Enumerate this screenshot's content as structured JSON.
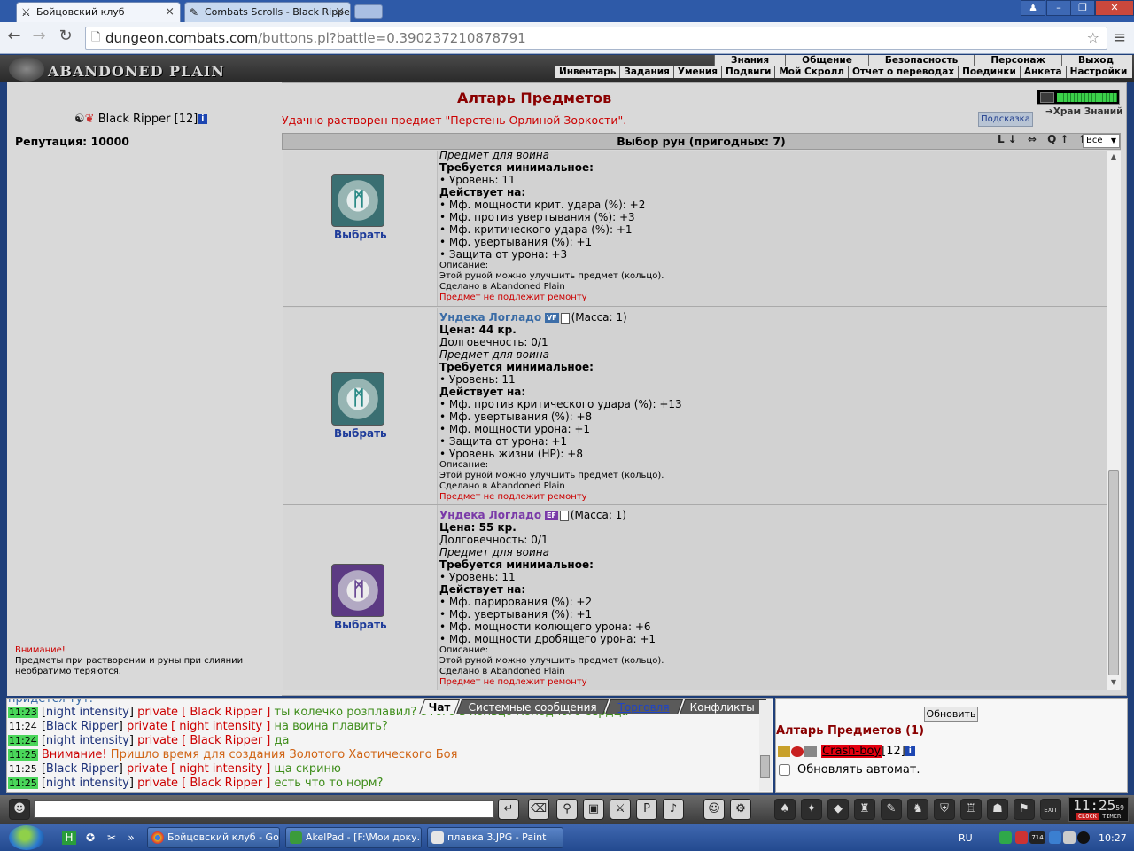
{
  "browser": {
    "tabs": [
      {
        "title": "Бойцовский клуб"
      },
      {
        "title": "Combats Scrolls - Black Ripper"
      }
    ],
    "url_host": "dungeon.combats.com",
    "url_path": "/buttons.pl?battle=0.390237210878791"
  },
  "game": {
    "logo": "ABANDONED PLAIN",
    "menu_top": [
      "Знания",
      "Общение",
      "Безопасность",
      "Персонаж",
      "Выход"
    ],
    "menu_bottom": [
      "Инвентарь",
      "Задания",
      "Умения",
      "Подвиги",
      "Мой Скролл",
      "Отчет о переводах",
      "Поединки",
      "Анкета",
      "Настройки"
    ]
  },
  "character": {
    "name": "Black Ripper",
    "level": "[12]",
    "reputation": "Репутация: 10000"
  },
  "page": {
    "title": "Алтарь Предметов",
    "status": "Удачно растворен предмет \"Перстень Орлиной Зоркости\".",
    "hint_button": "Подсказка",
    "temple_link": "Храм Знаний",
    "runes_header": "Выбор рун (пригодных: 7)",
    "sort_icons": "L↓ ⇔ Q↑ ⇅ ↺",
    "filter_value": "Все",
    "warning_title": "Внимание!",
    "warning_text": "Предметы при растворении и руны при слиянии необратимо теряются."
  },
  "items": [
    {
      "choose": "Выбрать",
      "partial_top": "Предмет для воина",
      "req_title": "Требуется минимальное:",
      "req": [
        "• Уровень: 11"
      ],
      "acts_title": "Действует на:",
      "acts": [
        "• Мф. мощности крит. удара (%): +2",
        "• Мф. против увертывания (%): +3",
        "• Мф. критического удара (%): +1",
        "• Мф. увертывания (%): +1",
        "• Защита от урона: +3"
      ],
      "desc_title": "Описание:",
      "desc": "Этой руной можно улучшить предмет (кольцо).",
      "made": "Сделано в Abandoned Plain",
      "repair": "Предмет не подлежит ремонту"
    },
    {
      "choose": "Выбрать",
      "name": "Ундека Логладо",
      "badge": "VF",
      "mass": "(Масса: 1)",
      "price": "Цена: 44 кр.",
      "durability": "Долговечность: 0/1",
      "for_class": "Предмет для воина",
      "req_title": "Требуется минимальное:",
      "req": [
        "• Уровень: 11"
      ],
      "acts_title": "Действует на:",
      "acts": [
        "• Мф. против критического удара (%): +13",
        "• Мф. увертывания (%): +8",
        "• Мф. мощности урона: +1",
        "• Защита от урона: +1",
        "• Уровень жизни (HP): +8"
      ],
      "desc_title": "Описание:",
      "desc": "Этой руной можно улучшить предмет (кольцо).",
      "made": "Сделано в Abandoned Plain",
      "repair": "Предмет не подлежит ремонту"
    },
    {
      "choose": "Выбрать",
      "name": "Ундека Логладо",
      "badge": "EF",
      "mass": "(Масса: 1)",
      "price": "Цена: 55 кр.",
      "durability": "Долговечность: 0/1",
      "for_class": "Предмет для воина",
      "req_title": "Требуется минимальное:",
      "req": [
        "• Уровень: 11"
      ],
      "acts_title": "Действует на:",
      "acts": [
        "• Мф. парирования (%): +2",
        "• Мф. увертывания (%): +1",
        "• Мф. мощности колющего урона: +6",
        "• Мф. мощности дробящего урона: +1"
      ],
      "desc_title": "Описание:",
      "desc": "Этой руной можно улучшить предмет (кольцо).",
      "made": "Сделано в Abandoned Plain",
      "repair": "Предмет не подлежит ремонту"
    }
  ],
  "chat": {
    "tabs": [
      "Чат",
      "Системные сообщения",
      "Торговля",
      "Конфликты"
    ],
    "partial_top": "придется тут.",
    "lines": [
      {
        "time": "11:23",
        "from": "night intensity",
        "priv": "private [ Black Ripper ]",
        "text": "ты колечко розплавил? Этого в кольцо Холодного сердца"
      },
      {
        "time": "11:24",
        "from": "Black Ripper",
        "priv": "private [ night intensity ]",
        "text": "на воина плавить?"
      },
      {
        "time": "11:24",
        "from": "night intensity",
        "priv": "private [ Black Ripper ]",
        "text": "да"
      },
      {
        "time": "11:25",
        "from": "Внимание!",
        "priv": "",
        "text": "Пришло время для создания Золотого Хаотического Боя"
      },
      {
        "time": "11:25",
        "from": "Black Ripper",
        "priv": "private [ night intensity ]",
        "text": "ща скриню"
      },
      {
        "time": "11:25",
        "from": "night intensity",
        "priv": "private [ Black Ripper ]",
        "text": "есть что то норм?"
      }
    ]
  },
  "room": {
    "refresh": "Обновить",
    "title": "Алтарь Предметов (1)",
    "player": "Crash-boy",
    "player_level": "[12]",
    "auto_refresh": "Обновлять автомат."
  },
  "clock": {
    "time": "11:25",
    "seconds": "59",
    "label_clock": "CLOCK",
    "label_timer": "TIMER",
    "exit": "EXIT"
  },
  "taskbar": {
    "tasks": [
      "Бойцовский клуб - Go...",
      "AkelPad - [F:\\Мои доку...",
      "плавка 3.JPG - Paint"
    ],
    "lang": "RU",
    "time": "10:27",
    "tray_badge": "714"
  }
}
